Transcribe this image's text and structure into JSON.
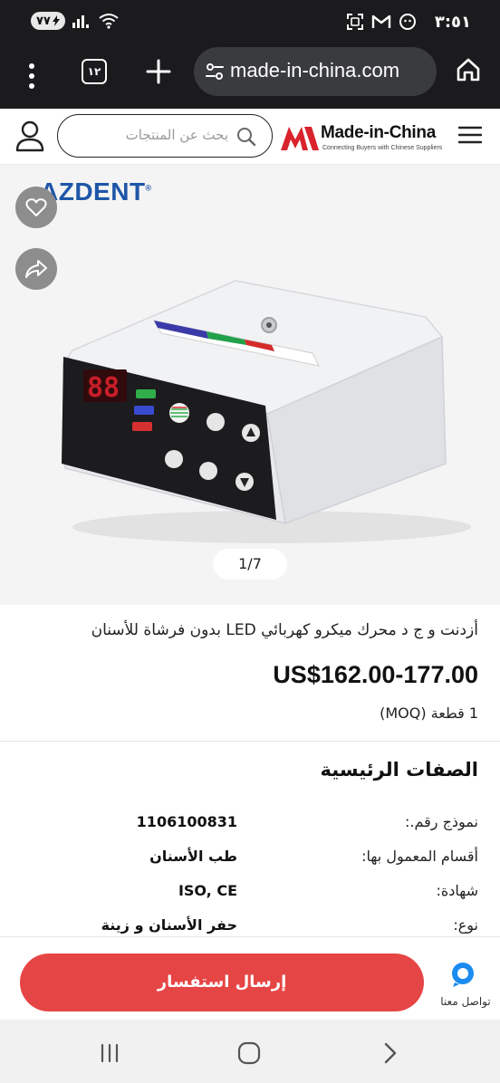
{
  "status_bar": {
    "time": "٣:٥١",
    "battery": "٧٧",
    "icons": [
      "battery-icon",
      "signal-icon",
      "wifi-icon",
      "screenshot-icon",
      "gmail-icon",
      "notification-icon"
    ]
  },
  "browser": {
    "url": "made-in-china.com",
    "tab_count": "١٢",
    "icons": [
      "menu-dots-icon",
      "tabs-icon",
      "plus-icon",
      "site-settings-icon",
      "home-icon"
    ]
  },
  "site_header": {
    "search_placeholder": "بحث عن المنتجات",
    "logo_name": "Made-in-China",
    "logo_tagline": "Connecting Buyers with Chinese Suppliers",
    "icons": [
      "user-icon",
      "search-icon",
      "hamburger-icon"
    ]
  },
  "gallery": {
    "brand": "AZDENT",
    "counter": "1/7",
    "accent_colors": {
      "device_body": "#e9ebee",
      "panel": "#1c1c1e",
      "display": "#c81e28"
    }
  },
  "product": {
    "title": "أزدنت و ج د محرك ميكرو كهربائي LED بدون فرشاة للأسنان",
    "price": "US$162.00-177.00",
    "moq": "1 قطعة (MOQ)"
  },
  "attributes": {
    "title": "الصفات الرئيسية",
    "rows": [
      {
        "key": "نموذج رقم.:",
        "value": "1106100831"
      },
      {
        "key": "أقسام المعمول بها:",
        "value": "طب الأسنان"
      },
      {
        "key": "شهادة:",
        "value": "ISO, CE"
      },
      {
        "key": "نوع:",
        "value": "حفر الأسنان و زينة"
      }
    ]
  },
  "actions": {
    "inquiry_label": "إرسال استفسار",
    "chat_label": "تواصل معنا",
    "inquiry_color": "#e64545",
    "chat_color": "#1a8cf0"
  },
  "nav_bar": {
    "icons": [
      "recents-icon",
      "home-circle-icon",
      "back-icon"
    ]
  }
}
